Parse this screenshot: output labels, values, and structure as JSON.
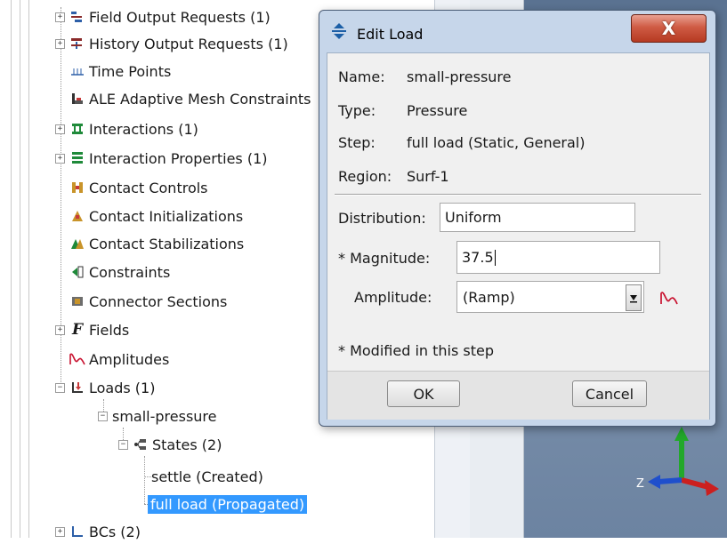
{
  "tree": {
    "items": [
      {
        "label": "Field Output Requests (1)",
        "icon": "field-output-icon"
      },
      {
        "label": "History Output Requests (1)",
        "icon": "history-output-icon"
      },
      {
        "label": "Time Points",
        "icon": "time-points-icon"
      },
      {
        "label": "ALE Adaptive Mesh Constraints",
        "icon": "ale-mesh-icon"
      },
      {
        "label": "Interactions (1)",
        "icon": "interactions-icon"
      },
      {
        "label": "Interaction Properties (1)",
        "icon": "interaction-properties-icon"
      },
      {
        "label": "Contact Controls",
        "icon": "contact-controls-icon"
      },
      {
        "label": "Contact Initializations",
        "icon": "contact-initializations-icon"
      },
      {
        "label": "Contact Stabilizations",
        "icon": "contact-stabilizations-icon"
      },
      {
        "label": "Constraints",
        "icon": "constraints-icon"
      },
      {
        "label": "Connector Sections",
        "icon": "connector-sections-icon"
      },
      {
        "label": "Fields",
        "icon": "fields-icon"
      },
      {
        "label": "Amplitudes",
        "icon": "amplitudes-icon"
      },
      {
        "label": "Loads (1)",
        "icon": "loads-icon"
      },
      {
        "label": "small-pressure",
        "icon": ""
      },
      {
        "label": "States (2)",
        "icon": "states-icon"
      },
      {
        "label": "settle (Created)",
        "icon": ""
      },
      {
        "label": "full load (Propagated)",
        "icon": ""
      },
      {
        "label": "BCs (2)",
        "icon": "bcs-icon"
      }
    ]
  },
  "dialog": {
    "title": "Edit Load",
    "close_label": "X",
    "name_key": "Name:",
    "name_value": "small-pressure",
    "type_key": "Type:",
    "type_value": "Pressure",
    "step_key": "Step:",
    "step_value": "full load (Static, General)",
    "region_key": "Region:",
    "region_value": "Surf-1",
    "distribution_label": "Distribution:",
    "distribution_value": "Uniform",
    "magnitude_label": "* Magnitude:",
    "magnitude_value": "37.5",
    "amplitude_label": "Amplitude:",
    "amplitude_value": "(Ramp)",
    "note": "* Modified in this step",
    "ok_label": "OK",
    "cancel_label": "Cancel"
  },
  "viewport": {
    "axis_label": "Z",
    "colors": {
      "x_axis": "#cc1f1f",
      "y_axis": "#22a82a",
      "z_axis": "#1f4fcc"
    }
  },
  "colors": {
    "selection": "#3399ff",
    "amplitude_icon": "#c8102e"
  }
}
